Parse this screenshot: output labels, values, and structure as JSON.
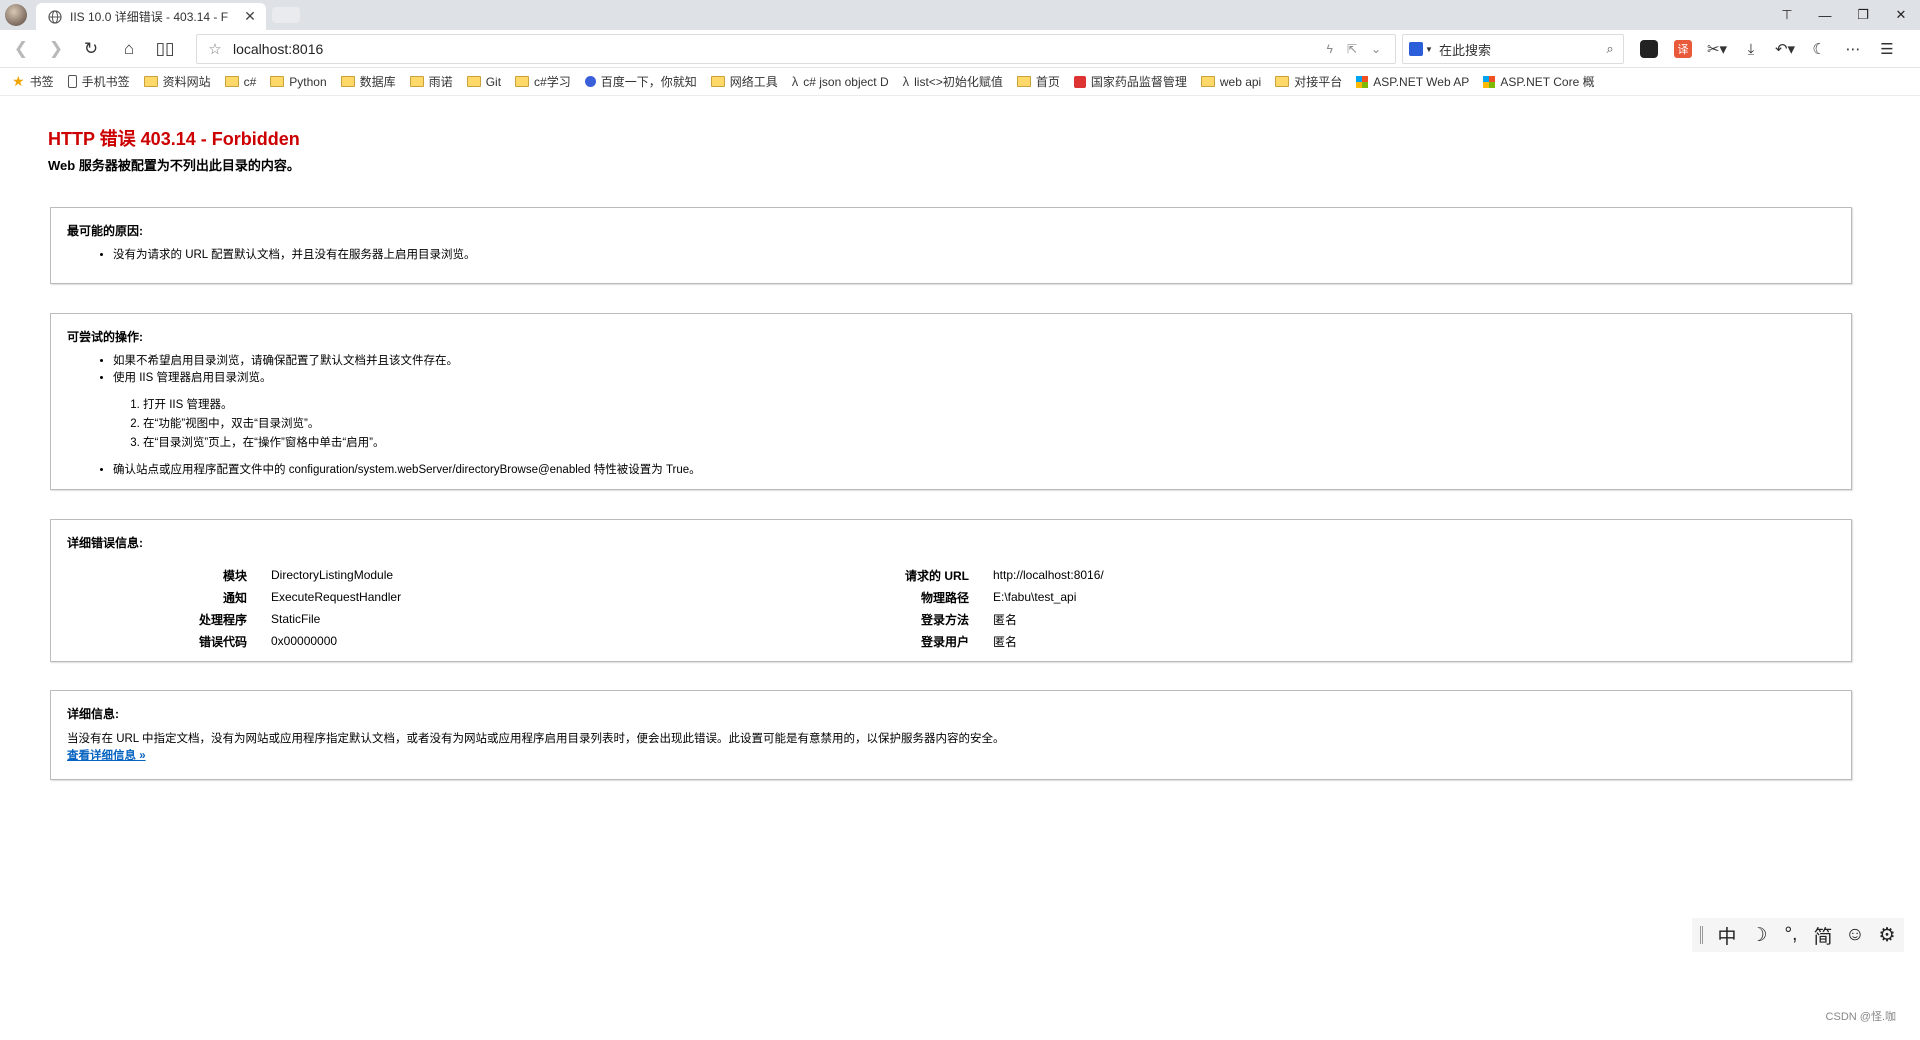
{
  "browser": {
    "tab_title": "IIS 10.0 详细错误 - 403.14 - F",
    "address": "localhost:8016",
    "search_placeholder": "在此搜索",
    "translate_label": "译",
    "bookmarks": [
      {
        "label": "书签",
        "icon": "star-icon"
      },
      {
        "label": "手机书签",
        "icon": "phone-icon"
      },
      {
        "label": "资料网站",
        "icon": "folder-icon"
      },
      {
        "label": "c#",
        "icon": "folder-icon"
      },
      {
        "label": "Python",
        "icon": "folder-icon"
      },
      {
        "label": "数据库",
        "icon": "folder-icon"
      },
      {
        "label": "雨诺",
        "icon": "folder-icon"
      },
      {
        "label": "Git",
        "icon": "folder-icon"
      },
      {
        "label": "c#学习",
        "icon": "folder-icon"
      },
      {
        "label": "百度一下，你就知",
        "icon": "baidu-paw-icon"
      },
      {
        "label": "网络工具",
        "icon": "folder-icon"
      },
      {
        "label": "c# json object D",
        "icon": "lambda-icon"
      },
      {
        "label": "list<>初始化赋值",
        "icon": "lambda-icon"
      },
      {
        "label": "首页",
        "icon": "site-icon"
      },
      {
        "label": "国家药品监督管理",
        "icon": "emblem-icon"
      },
      {
        "label": "web api",
        "icon": "folder-icon"
      },
      {
        "label": "对接平台",
        "icon": "folder-icon"
      },
      {
        "label": "ASP.NET Web AP",
        "icon": "microsoft-icon"
      },
      {
        "label": "ASP.NET Core 概",
        "icon": "microsoft-icon"
      }
    ]
  },
  "error": {
    "title": "HTTP 错误 403.14 - Forbidden",
    "subtitle": "Web 服务器被配置为不列出此目录的内容。",
    "cause_heading": "最可能的原因:",
    "causes": [
      "没有为请求的 URL 配置默认文档，并且没有在服务器上启用目录浏览。"
    ],
    "actions_heading": "可尝试的操作:",
    "actions": [
      "如果不希望启用目录浏览，请确保配置了默认文档并且该文件存在。",
      "使用 IIS 管理器启用目录浏览。"
    ],
    "steps": [
      "打开 IIS 管理器。",
      "在“功能”视图中，双击“目录浏览”。",
      "在“目录浏览”页上，在“操作”窗格中单击“启用”。"
    ],
    "action_last": "确认站点或应用程序配置文件中的 configuration/system.webServer/directoryBrowse@enabled 特性被设置为 True。",
    "details_heading": "详细错误信息:",
    "details_left": [
      {
        "key": "模块",
        "value": "DirectoryListingModule"
      },
      {
        "key": "通知",
        "value": "ExecuteRequestHandler"
      },
      {
        "key": "处理程序",
        "value": "StaticFile"
      },
      {
        "key": "错误代码",
        "value": "0x00000000"
      }
    ],
    "details_right": [
      {
        "key": "请求的 URL",
        "value": "http://localhost:8016/"
      },
      {
        "key": "物理路径",
        "value": "E:\\fabu\\test_api"
      },
      {
        "key": "登录方法",
        "value": "匿名"
      },
      {
        "key": "登录用户",
        "value": "匿名"
      }
    ],
    "more_heading": "详细信息:",
    "more_text": "当没有在 URL 中指定文档，没有为网站或应用程序指定默认文档，或者没有为网站或应用程序启用目录列表时，便会出现此错误。此设置可能是有意禁用的，以保护服务器内容的安全。",
    "more_link": "查看详细信息 »"
  },
  "ime": {
    "lang": "中",
    "moon": "☽",
    "punct": "°,",
    "script": "简",
    "emoji": "☺",
    "settings": "⚙"
  },
  "watermark": "CSDN @怪.咖"
}
